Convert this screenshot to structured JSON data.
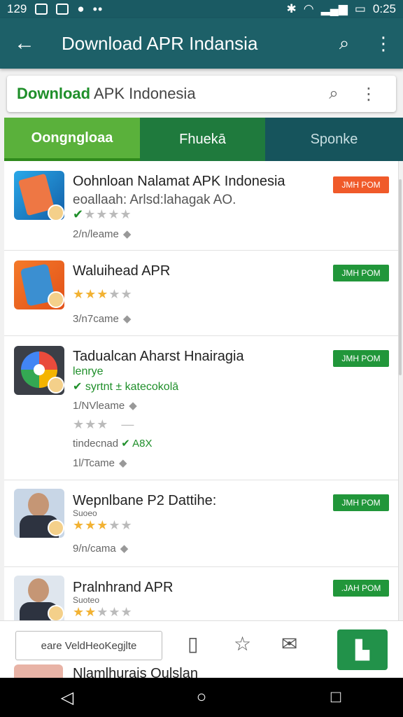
{
  "status": {
    "time_left": "129",
    "time_right": "0:25"
  },
  "app_bar": {
    "title": "Download APR Indansia"
  },
  "search": {
    "highlight": "Download",
    "rest": " APK Indonesia"
  },
  "tabs": [
    {
      "label": "Oongngloaa"
    },
    {
      "label": "Fhuekā"
    },
    {
      "label": "Sponke"
    }
  ],
  "apps": [
    {
      "name": "Oohnloan Nalamat APK Indonesia",
      "sub": "eoallaah: Arlsd:lahagak AO.",
      "meta": "2/n/leame",
      "button": "JMH POM",
      "rating": 2
    },
    {
      "name": "Waluihead APR",
      "meta": "3/n7came",
      "button": "JMH POM",
      "rating": 3
    },
    {
      "name": "Tadualcan Aharst Hnairagia",
      "green1": "lenrye",
      "green2": "syrtnt ± katecokolā",
      "meta": "1/NVleame",
      "extra1": "tindecnad",
      "extra2": "A8X",
      "meta2": "1l/Tcame",
      "button": "JMH POM"
    },
    {
      "name": "Wepnlbane P2 Dattihe:",
      "sub": "Suoeo",
      "meta": "9/n/cama",
      "button": "JMH POM",
      "rating": 3
    },
    {
      "name": "Pralnhrand APR",
      "sub": "Suoteo",
      "button": ".JAH POM",
      "rating": 2
    }
  ],
  "bottom": {
    "input": "eare VeldHeoKegjlte",
    "peek": "Nlamlhurais Oulslan"
  },
  "colors": {
    "header": "#1d6068",
    "tab_active": "#5ab13b",
    "install_green": "#21963a",
    "install_orange": "#f05a2a"
  }
}
